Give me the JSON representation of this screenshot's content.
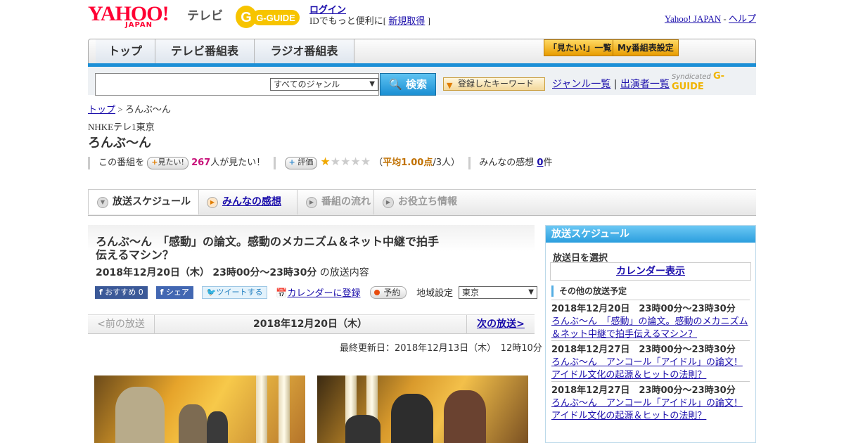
{
  "header": {
    "logo_text": "YAHOO!",
    "logo_sub": "JAPAN",
    "tv_label": "テレビ",
    "gguide_label": "G-GUIDE",
    "login_label": "ログイン",
    "login_prefix": "IDでもっと便利に[",
    "signup_label": "新規取得",
    "login_suffix": "]",
    "yahoo_japan_link": "Yahoo! JAPAN",
    "dash": "-",
    "help_link": "ヘルプ"
  },
  "nav": {
    "tabs": [
      {
        "label": "トップ"
      },
      {
        "label": "テレビ番組表"
      },
      {
        "label": "ラジオ番組表"
      }
    ],
    "mitai_list": "「見たい!」一覧",
    "my_bangumi": "My番組表設定"
  },
  "search": {
    "placeholder": "",
    "genre_selected": "すべてのジャンル",
    "search_button": "検索",
    "keyword_button": "登録したキーワード",
    "genre_list": "ジャンル一覧",
    "separator": "|",
    "performer_list": "出演者一覧",
    "syndicated": "Syndicated"
  },
  "breadcrumb": {
    "top": "トップ",
    "sep": ">",
    "current": "ろんぶ～ん"
  },
  "program": {
    "station": "NHKEテレ1東京",
    "title": "ろんぶ～ん",
    "mitai_prefix": "この番組を",
    "mitai_button": "見たい!",
    "mitai_count": "267",
    "mitai_suffix": "人が見たい！",
    "rating_button": "評価",
    "rating_value": 1,
    "rating_max": 5,
    "avg_open": "（",
    "avg_label": "平均1.00点",
    "avg_people": "/3人）",
    "comments_prefix": "みんなの感想",
    "comments_count": "0",
    "comments_suffix": "件"
  },
  "tabs": [
    {
      "label": "放送スケジュール"
    },
    {
      "label": "みんなの感想"
    },
    {
      "label": "番組の流れ"
    },
    {
      "label": "お役立ち情報"
    }
  ],
  "episode": {
    "title": "ろんぶ～ん　「感動」の論文。感動のメカニズム＆ネット中継で拍手伝えるマシン？",
    "date": "2018年12月20日（木）",
    "time": "23時00分～23時30分",
    "suffix": "の放送内容",
    "fb_recommend": "おすすめ 0",
    "fb_share": "シェア",
    "tweet": "ツイートする",
    "calendar_register": "カレンダーに登録",
    "reserve": "予約",
    "region_label": "地域設定",
    "region_value": "東京"
  },
  "pager": {
    "prev": "<前の放送",
    "date": "2018年12月20日（木）",
    "next": "次の放送>"
  },
  "updated": "最終更新日：2018年12月13日（木）　12時10分",
  "sidebar": {
    "heading": "放送スケジュール",
    "select_label": "放送日を選択",
    "calendar_button": "カレンダー表示",
    "other_heading": "その他の放送予定",
    "items": [
      {
        "date": "2018年12月20日　23時00分～23時30分",
        "title": "ろんぶ～ん　「感動」の論文。感動のメカニズム＆ネット中継で拍手伝えるマシン？"
      },
      {
        "date": "2018年12月27日　23時00分～23時30分",
        "title": "ろんぶ～ん　アンコール「アイドル」の論文！アイドル文化の起源＆ヒットの法則？"
      },
      {
        "date": "2018年12月27日　23時00分～23時30分",
        "title": "ろんぶ～ん　アンコール「アイドル」の論文！アイドル文化の起源＆ヒットの法則？"
      }
    ]
  }
}
